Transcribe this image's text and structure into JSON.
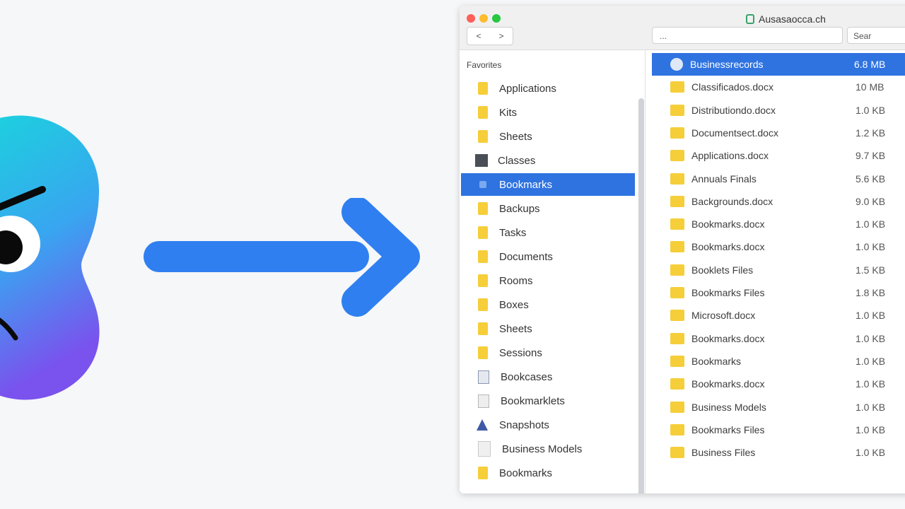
{
  "window": {
    "title": "Ausasaocca.ch",
    "nav_back": "<",
    "nav_forward": ">",
    "path_text": "...",
    "search_text": "Sear"
  },
  "sidebar": {
    "header": "Favorites",
    "items": [
      {
        "label": "Applications",
        "icon": "folder-icon"
      },
      {
        "label": "Kits",
        "icon": "folder-icon"
      },
      {
        "label": "Sheets",
        "icon": "folder-icon"
      },
      {
        "label": "Classes",
        "icon": "dark-square-icon"
      },
      {
        "label": "Bookmarks",
        "icon": "selected-item-icon",
        "selected": true
      },
      {
        "label": "Backups",
        "icon": "folder-icon"
      },
      {
        "label": "Tasks",
        "icon": "folder-icon"
      },
      {
        "label": "Documents",
        "icon": "folder-icon"
      },
      {
        "label": "Rooms",
        "icon": "folder-icon"
      },
      {
        "label": "Boxes",
        "icon": "folder-icon"
      },
      {
        "label": "Sheets",
        "icon": "folder-icon"
      },
      {
        "label": "Sessions",
        "icon": "folder-icon"
      },
      {
        "label": "Bookcases",
        "icon": "document-icon"
      },
      {
        "label": "Bookmarklets",
        "icon": "document-gray-icon"
      },
      {
        "label": "Snapshots",
        "icon": "triangle-icon"
      },
      {
        "label": "Business Models",
        "icon": "page-icon"
      },
      {
        "label": "Bookmarks",
        "icon": "folder-icon"
      }
    ]
  },
  "files": [
    {
      "name": "Businessrecords",
      "size": "6.8 MB",
      "selected": true
    },
    {
      "name": "Classificados.docx",
      "size": "10 MB"
    },
    {
      "name": "Distributiondo.docx",
      "size": "1.0 KB"
    },
    {
      "name": "Documentsect.docx",
      "size": "1.2 KB"
    },
    {
      "name": "Applications.docx",
      "size": "9.7 KB"
    },
    {
      "name": "Annuals Finals",
      "size": "5.6 KB"
    },
    {
      "name": "Backgrounds.docx",
      "size": "9.0 KB"
    },
    {
      "name": "Bookmarks.docx",
      "size": "1.0 KB"
    },
    {
      "name": "Bookmarks.docx",
      "size": "1.0 KB"
    },
    {
      "name": "Booklets Files",
      "size": "1.5 KB"
    },
    {
      "name": "Bookmarks Files",
      "size": "1.8 KB"
    },
    {
      "name": "Microsoft.docx",
      "size": "1.0 KB"
    },
    {
      "name": "Bookmarks.docx",
      "size": "1.0 KB"
    },
    {
      "name": "Bookmarks",
      "size": "1.0 KB"
    },
    {
      "name": "Bookmarks.docx",
      "size": "1.0 KB"
    },
    {
      "name": "Business Models",
      "size": "1.0 KB"
    },
    {
      "name": "Bookmarks Files",
      "size": "1.0 KB"
    },
    {
      "name": "Business Files",
      "size": "1.0 KB"
    }
  ],
  "colors": {
    "accent": "#2f73e0",
    "folder": "#f5ce3a",
    "arrow": "#2f7ff0"
  }
}
